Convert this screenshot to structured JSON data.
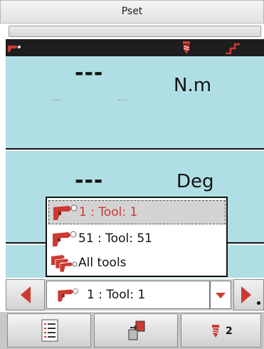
{
  "header": {
    "title": "Pset",
    "subtitle": ""
  },
  "torque": {
    "value": "---",
    "unit": "N.m",
    "low_limit": "---",
    "high_limit": "---"
  },
  "angle": {
    "value": "---",
    "unit": "Deg"
  },
  "tool_dropdown": {
    "items": [
      {
        "label": "1 : Tool: 1",
        "icon": "tool-icon",
        "selected": true
      },
      {
        "label": "51 : Tool: 51",
        "icon": "tool-icon",
        "selected": false
      },
      {
        "label": "All tools",
        "icon": "all-tools-icon",
        "selected": false
      }
    ]
  },
  "tool_selector": {
    "value": "1 : Tool: 1"
  },
  "toolbar": {
    "screw_count": "2"
  },
  "colors": {
    "accent_red": "#cc3a33",
    "panel_blue": "#afdfe4",
    "status_strip": "#1e1e1e"
  }
}
